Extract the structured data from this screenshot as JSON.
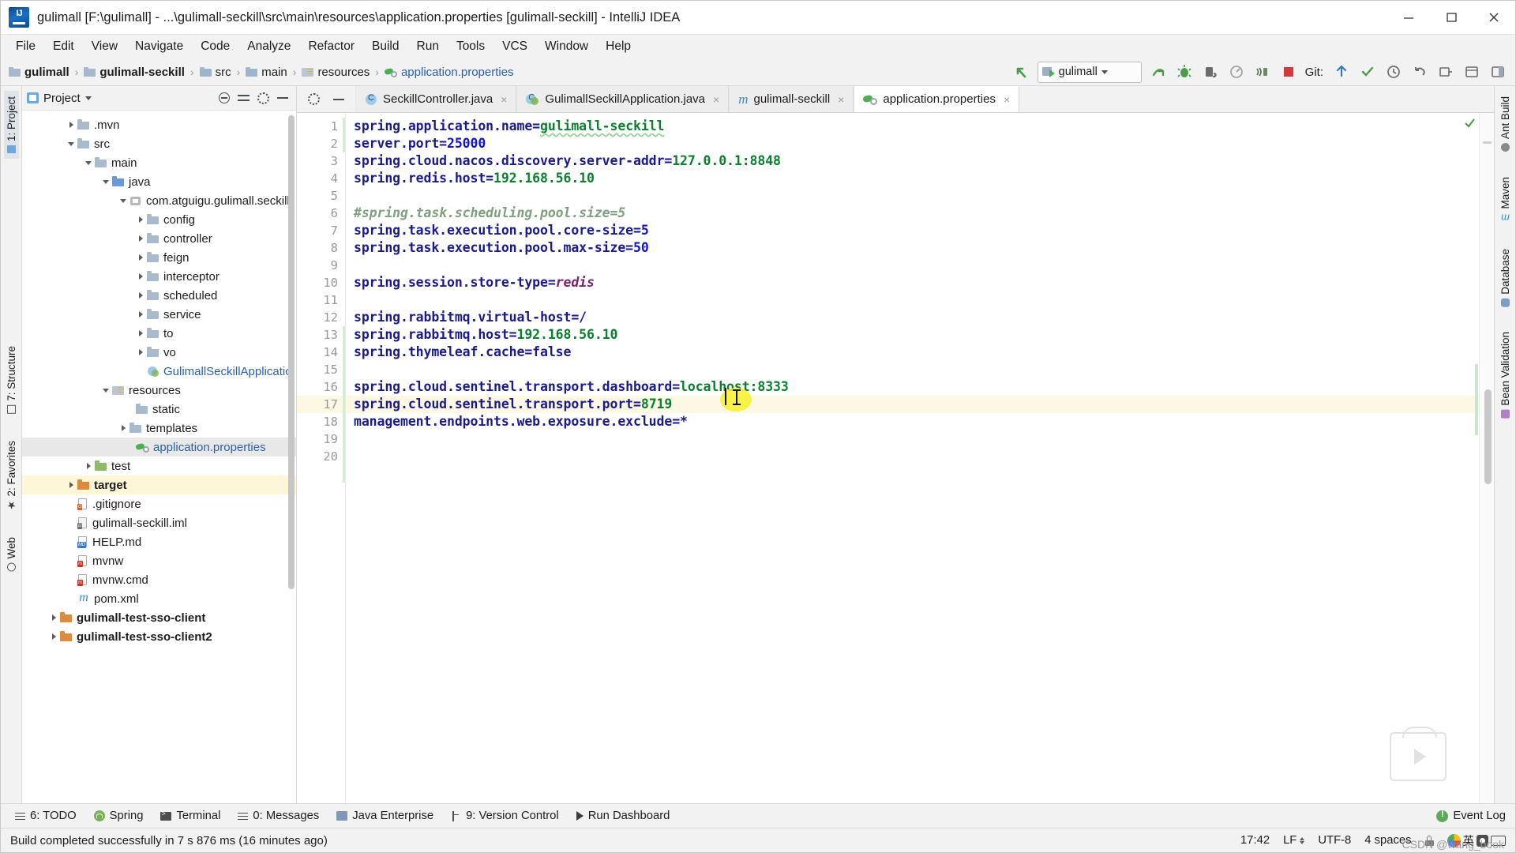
{
  "window": {
    "title": "gulimall [F:\\gulimall] - ...\\gulimall-seckill\\src\\main\\resources\\application.properties [gulimall-seckill] - IntelliJ IDEA",
    "app_icon": "intellij-idea-logo",
    "minimize": "minimize-icon",
    "maximize": "maximize-icon",
    "close": "close-icon"
  },
  "menubar": {
    "items": [
      {
        "label": "File"
      },
      {
        "label": "Edit"
      },
      {
        "label": "View"
      },
      {
        "label": "Navigate"
      },
      {
        "label": "Code"
      },
      {
        "label": "Analyze"
      },
      {
        "label": "Refactor"
      },
      {
        "label": "Build"
      },
      {
        "label": "Run"
      },
      {
        "label": "Tools"
      },
      {
        "label": "VCS"
      },
      {
        "label": "Window"
      },
      {
        "label": "Help"
      }
    ]
  },
  "breadcrumb": {
    "items": [
      {
        "label": "gulimall",
        "icon": "folder-icon"
      },
      {
        "label": "gulimall-seckill",
        "icon": "folder-icon"
      },
      {
        "label": "src",
        "icon": "folder-icon"
      },
      {
        "label": "main",
        "icon": "folder-icon"
      },
      {
        "label": "resources",
        "icon": "resources-folder-icon"
      },
      {
        "label": "application.properties",
        "icon": "properties-file-icon"
      }
    ],
    "separator": "›"
  },
  "toolbar": {
    "back_arrow": "back-arrow-icon",
    "run_config": {
      "label": "gulimall",
      "icon": "run-config-icon",
      "caret": "chevron-down-icon"
    },
    "run": "run-icon",
    "debug": "debug-icon",
    "run_with_coverage": "run-coverage-icon",
    "profile": "profiler-icon",
    "attach": "attach-icon",
    "stop": "stop-icon",
    "git_label": "Git:",
    "update_project": "update-project-icon",
    "commit": "commit-icon",
    "history": "history-icon",
    "rollback": "rollback-icon",
    "search_everywhere": "search-everywhere-icon",
    "settings": "settings-icon",
    "layout": "layout-icon"
  },
  "left_strip": {
    "items": [
      {
        "label": "1: Project",
        "icon": "project-icon",
        "selected": true
      },
      {
        "label": "7: Structure",
        "icon": "structure-icon",
        "selected": false
      },
      {
        "label": "2: Favorites",
        "icon": "favorites-star-icon",
        "selected": false
      },
      {
        "label": "Web",
        "icon": "web-icon",
        "selected": false
      }
    ]
  },
  "right_strip": {
    "items": [
      {
        "label": "Ant Build",
        "icon": "ant-icon"
      },
      {
        "label": "Maven",
        "icon": "maven-icon"
      },
      {
        "label": "Database",
        "icon": "database-icon"
      },
      {
        "label": "Bean Validation",
        "icon": "bean-validation-icon"
      }
    ]
  },
  "project_panel": {
    "title": "Project",
    "title_caret": "chevron-down-icon",
    "actions": [
      "locate-icon",
      "collapse-all-icon",
      "settings-gear-icon",
      "hide-icon"
    ],
    "tree": [
      {
        "label": ".mvn",
        "indent": 2,
        "arrow": "right",
        "icon": "folder",
        "bold": false
      },
      {
        "label": "src",
        "indent": 2,
        "arrow": "down",
        "icon": "folder",
        "bold": false
      },
      {
        "label": "main",
        "indent": 3,
        "arrow": "down",
        "icon": "folder",
        "bold": false
      },
      {
        "label": "java",
        "indent": 4,
        "arrow": "down",
        "icon": "folder-blue",
        "bold": false
      },
      {
        "label": "com.atguigu.gulimall.seckill",
        "indent": 5,
        "arrow": "down",
        "icon": "package",
        "bold": false
      },
      {
        "label": "config",
        "indent": 6,
        "arrow": "right",
        "icon": "folder",
        "bold": false
      },
      {
        "label": "controller",
        "indent": 6,
        "arrow": "right",
        "icon": "folder",
        "bold": false
      },
      {
        "label": "feign",
        "indent": 6,
        "arrow": "right",
        "icon": "folder",
        "bold": false
      },
      {
        "label": "interceptor",
        "indent": 6,
        "arrow": "right",
        "icon": "folder",
        "bold": false
      },
      {
        "label": "scheduled",
        "indent": 6,
        "arrow": "right",
        "icon": "folder",
        "bold": false
      },
      {
        "label": "service",
        "indent": 6,
        "arrow": "right",
        "icon": "folder",
        "bold": false
      },
      {
        "label": "to",
        "indent": 6,
        "arrow": "right",
        "icon": "folder",
        "bold": false
      },
      {
        "label": "vo",
        "indent": 6,
        "arrow": "right",
        "icon": "folder",
        "bold": false
      },
      {
        "label": "GulimallSeckillApplicatio",
        "indent": 6,
        "arrow": "none",
        "icon": "spring-class",
        "bold": false,
        "color": "#2b5fa8"
      },
      {
        "label": "resources",
        "indent": 4,
        "arrow": "down",
        "icon": "resources",
        "bold": false
      },
      {
        "label": "static",
        "indent": 5,
        "arrow": "none",
        "icon": "folder",
        "bold": false
      },
      {
        "label": "templates",
        "indent": 5,
        "arrow": "right",
        "icon": "folder",
        "bold": false
      },
      {
        "label": "application.properties",
        "indent": 5,
        "arrow": "none",
        "icon": "properties",
        "bold": false,
        "selected": true,
        "color": "#2b5fa8"
      },
      {
        "label": "test",
        "indent": 3,
        "arrow": "right",
        "icon": "folder-green",
        "bold": false
      },
      {
        "label": "target",
        "indent": 2,
        "arrow": "right",
        "icon": "folder-orange",
        "bold": true,
        "highlight": true
      },
      {
        "label": ".gitignore",
        "indent": 2,
        "arrow": "none",
        "icon": "file-gitignore",
        "bold": false
      },
      {
        "label": "gulimall-seckill.iml",
        "indent": 2,
        "arrow": "none",
        "icon": "file-iml",
        "bold": false
      },
      {
        "label": "HELP.md",
        "indent": 2,
        "arrow": "none",
        "icon": "file-md",
        "bold": false
      },
      {
        "label": "mvnw",
        "indent": 2,
        "arrow": "none",
        "icon": "file-mvn",
        "bold": false
      },
      {
        "label": "mvnw.cmd",
        "indent": 2,
        "arrow": "none",
        "icon": "file-mvn",
        "bold": false
      },
      {
        "label": "pom.xml",
        "indent": 2,
        "arrow": "none",
        "icon": "pom",
        "bold": false
      },
      {
        "label": "gulimall-test-sso-client",
        "indent": 1,
        "arrow": "right",
        "icon": "folder-orange",
        "bold": true
      },
      {
        "label": "gulimall-test-sso-client2",
        "indent": 1,
        "arrow": "right",
        "icon": "folder-orange",
        "bold": true
      }
    ]
  },
  "editor": {
    "tabs": [
      {
        "label": "SeckillController.java",
        "icon": "java-class-icon",
        "active": false,
        "close": "×"
      },
      {
        "label": "GulimallSeckillApplication.java",
        "icon": "spring-class-icon",
        "active": false,
        "close": "×"
      },
      {
        "label": "gulimall-seckill",
        "icon": "maven-module-icon",
        "active": false,
        "close": "×"
      },
      {
        "label": "application.properties",
        "icon": "properties-file-icon",
        "active": true,
        "close": "×"
      }
    ],
    "tab_controls": [
      "settings-gear-icon",
      "hide-icon"
    ],
    "lines": [
      {
        "n": 1,
        "segments": [
          {
            "t": "spring.application.name=",
            "c": "k"
          },
          {
            "t": "gulimall-seckill",
            "c": "v-str squiggle"
          }
        ]
      },
      {
        "n": 2,
        "segments": [
          {
            "t": "server.port=",
            "c": "k"
          },
          {
            "t": "25000",
            "c": "v-num"
          }
        ]
      },
      {
        "n": 3,
        "segments": [
          {
            "t": "spring.cloud.nacos.discovery.server-addr=",
            "c": "k"
          },
          {
            "t": "127.0.0.1:8848",
            "c": "v-str"
          }
        ]
      },
      {
        "n": 4,
        "segments": [
          {
            "t": "spring.redis.host=",
            "c": "k"
          },
          {
            "t": "192.168.56.10",
            "c": "v-str"
          }
        ]
      },
      {
        "n": 5,
        "segments": []
      },
      {
        "n": 6,
        "segments": [
          {
            "t": "#spring.task.scheduling.pool.size=5",
            "c": "cmt"
          }
        ]
      },
      {
        "n": 7,
        "segments": [
          {
            "t": "spring.task.execution.pool.core-size=",
            "c": "k"
          },
          {
            "t": "5",
            "c": "v-num"
          }
        ]
      },
      {
        "n": 8,
        "segments": [
          {
            "t": "spring.task.execution.pool.max-size=",
            "c": "k"
          },
          {
            "t": "50",
            "c": "v-num"
          }
        ]
      },
      {
        "n": 9,
        "segments": []
      },
      {
        "n": 10,
        "segments": [
          {
            "t": "spring.session.store-type=",
            "c": "k"
          },
          {
            "t": "redis",
            "c": "v-ital"
          }
        ]
      },
      {
        "n": 11,
        "segments": []
      },
      {
        "n": 12,
        "segments": [
          {
            "t": "spring.rabbitmq.virtual-host=/",
            "c": "k"
          }
        ]
      },
      {
        "n": 13,
        "segments": [
          {
            "t": "spring.rabbitmq.host=",
            "c": "k"
          },
          {
            "t": "192.168.56.10",
            "c": "v-str"
          }
        ]
      },
      {
        "n": 14,
        "segments": [
          {
            "t": "spring.thymeleaf.cache=false",
            "c": "k"
          }
        ]
      },
      {
        "n": 15,
        "segments": []
      },
      {
        "n": 16,
        "segments": [
          {
            "t": "spring.cloud.sentinel.transport.dashboard=",
            "c": "k"
          },
          {
            "t": "localhost:8333",
            "c": "v-str"
          }
        ]
      },
      {
        "n": 17,
        "segments": [
          {
            "t": "spring.cloud.sentinel.transport.port=",
            "c": "k"
          },
          {
            "t": "8719",
            "c": "v-str"
          }
        ],
        "highlight": true
      },
      {
        "n": 18,
        "segments": [
          {
            "t": "management.endpoints.web.exposure.exclude=*",
            "c": "k"
          }
        ]
      },
      {
        "n": 19,
        "segments": []
      },
      {
        "n": 20,
        "segments": []
      }
    ],
    "caret_line": 17,
    "cursor_badge": "mouse-cursor-highlight",
    "inspection_status": "inspections-ok-icon",
    "watermark": "video-play-watermark"
  },
  "bottom_toolwindows": {
    "items": [
      {
        "label": "6: TODO",
        "icon": "todo-icon"
      },
      {
        "label": "Spring",
        "icon": "spring-icon"
      },
      {
        "label": "Terminal",
        "icon": "terminal-icon"
      },
      {
        "label": "0: Messages",
        "icon": "messages-icon"
      },
      {
        "label": "Java Enterprise",
        "icon": "java-enterprise-icon"
      },
      {
        "label": "9: Version Control",
        "icon": "version-control-icon"
      },
      {
        "label": "Run Dashboard",
        "icon": "run-dashboard-icon"
      }
    ],
    "event_log": {
      "label": "Event Log",
      "icon": "event-log-icon"
    }
  },
  "statusbar": {
    "message": "Build completed successfully in 7 s 876 ms (16 minutes ago)",
    "caret_position": "17:42",
    "line_separator": "LF",
    "line_separator_caret": "chevron-updown-icon",
    "encoding": "UTF-8",
    "indent": "4 spaces",
    "lock": "read-only-lock-icon",
    "ime_language": "英",
    "ime_logo": "sogou-input-icon",
    "ime_mode": "ime-mode-icon",
    "ime_keyboard": "ime-keyboard-icon"
  },
  "watermark_text": "CSDN @wang_book",
  "colors": {
    "accent_blue": "#2b5fa8",
    "key_blue": "#1a1a8c",
    "value_green": "#0a7f2e",
    "number_blue": "#1414c8",
    "comment_green": "#7f9e7f",
    "highlight_yellow": "#fdf8e3",
    "cursor_highlight": "#f7f02a",
    "panel_bg": "#f2f2f2"
  }
}
